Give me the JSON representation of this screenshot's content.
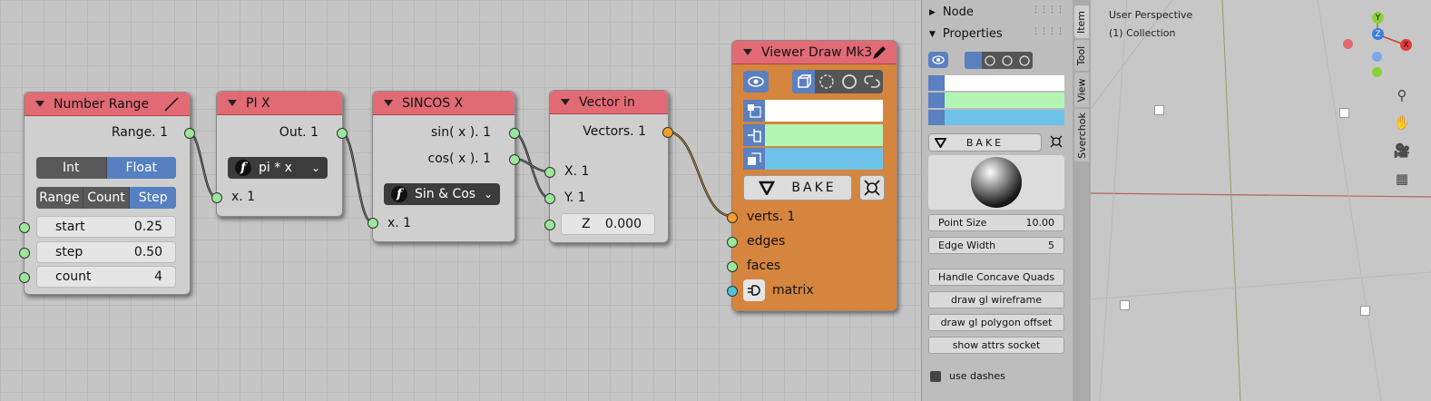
{
  "nodes": {
    "number_range": {
      "title": "Number Range",
      "output": "Range. 1",
      "mode_int": "Int",
      "mode_float": "Float",
      "tab_range": "Range",
      "tab_count": "Count",
      "tab_step": "Step",
      "start_label": "start",
      "start_value": "0.25",
      "step_label": "step",
      "step_value": "0.50",
      "count_label": "count",
      "count_value": "4"
    },
    "pi_x": {
      "title": "PI X",
      "output": "Out. 1",
      "function": "pi * x",
      "input": "x. 1"
    },
    "sincos_x": {
      "title": "SINCOS X",
      "output_sin": "sin( x ). 1",
      "output_cos": "cos( x ). 1",
      "function": "Sin & Cos",
      "input": "x. 1"
    },
    "vector_in": {
      "title": "Vector in",
      "output": "Vectors. 1",
      "input_x": "X. 1",
      "input_y": "Y. 1",
      "z_label": "Z",
      "z_value": "0.000"
    },
    "viewer": {
      "title": "Viewer Draw Mk3",
      "bake": "BAKE",
      "input_verts": "verts. 1",
      "input_edges": "edges",
      "input_faces": "faces",
      "input_matrix": "matrix"
    }
  },
  "sidebar": {
    "node_panel": "Node",
    "properties_panel": "Properties",
    "bake": "BAKE",
    "point_size_label": "Point Size",
    "point_size_value": "10.00",
    "edge_width_label": "Edge Width",
    "edge_width_value": "5",
    "btn_concave": "Handle Concave Quads",
    "btn_wireframe": "draw gl wireframe",
    "btn_polygon_offset": "draw gl polygon offset",
    "btn_attrs": "show attrs socket",
    "use_dashes": "use dashes"
  },
  "tabs": [
    "Item",
    "Tool",
    "View",
    "Sverchok"
  ],
  "viewport": {
    "perspective": "User Perspective",
    "collection": "(1) Collection",
    "axis_x": "X",
    "axis_y": "Y",
    "axis_z": "Z"
  },
  "colors": {
    "vert_color": "#ffffff",
    "edge_color": "#b3f5b3",
    "face_color": "#6ec2ea",
    "node_header": "#e26a74",
    "viewer_body": "#d5853d",
    "accent": "#5680c2"
  }
}
